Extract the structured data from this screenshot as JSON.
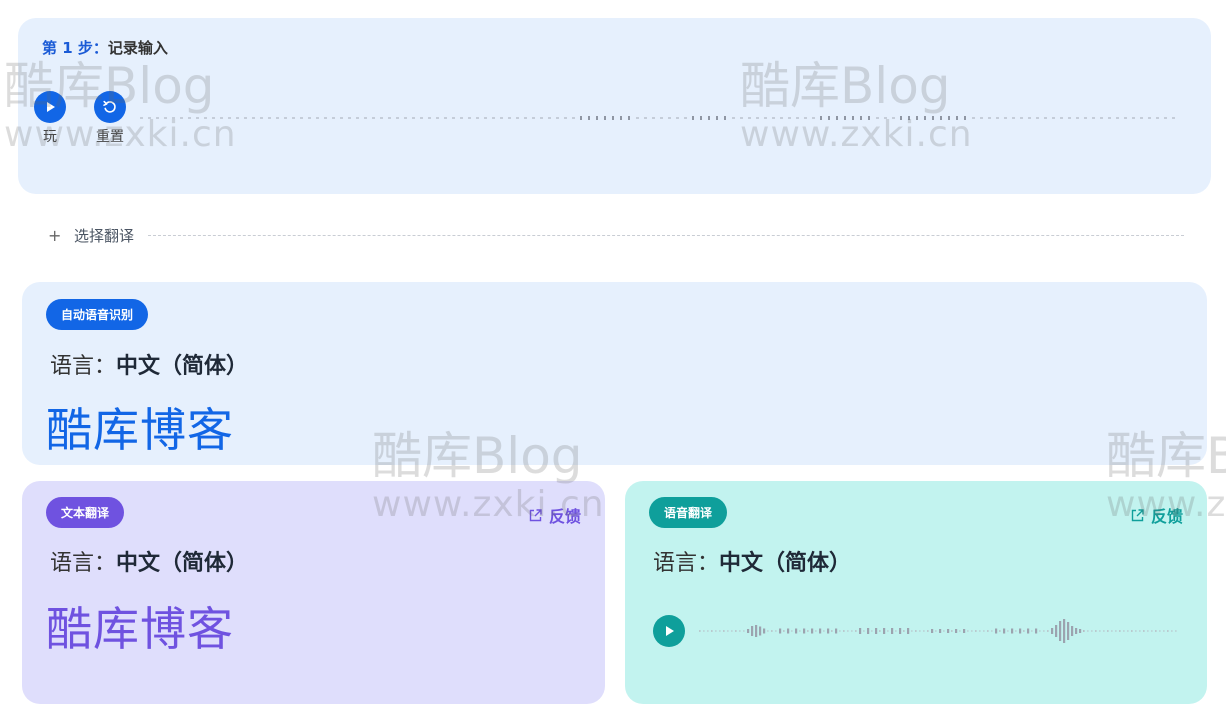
{
  "step": {
    "number_label": "第 1 步：",
    "title": "记录输入",
    "play_label": "玩",
    "reset_label": "重置"
  },
  "add_translation": {
    "label": "选择翻译"
  },
  "asr_card": {
    "badge": "自动语音识别",
    "language_label": "语言：",
    "language_value": "中文（简体）",
    "result_text": "酷库博客"
  },
  "text_translation_card": {
    "badge": "文本翻译",
    "feedback_label": "反馈",
    "language_label": "语言：",
    "language_value": "中文（简体）",
    "result_text": "酷库博客"
  },
  "speech_translation_card": {
    "badge": "语音翻译",
    "feedback_label": "反馈",
    "language_label": "语言：",
    "language_value": "中文（简体）"
  },
  "watermark": {
    "line1_prefix": "酷库",
    "line1_suffix": "Blog",
    "line2": "www.zxki.cn"
  },
  "icons": [
    "play-icon",
    "reset-icon",
    "plus-icon",
    "external-link-icon"
  ],
  "colors": {
    "primary_blue": "#1266e6",
    "purple": "#6f52e0",
    "teal": "#0f9f9b",
    "card_blue": "#e6f0fd",
    "card_purple": "#dfdefc",
    "card_teal": "#c2f3ef"
  }
}
